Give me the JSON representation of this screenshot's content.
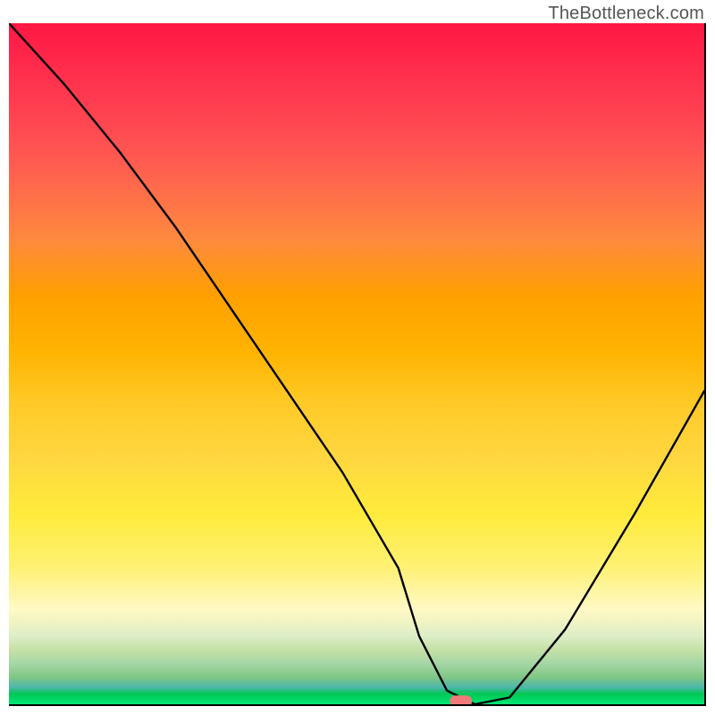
{
  "attribution": "TheBottleneck.com",
  "chart_data": {
    "type": "line",
    "title": "",
    "xlabel": "",
    "ylabel": "",
    "xlim": [
      0,
      100
    ],
    "ylim": [
      0,
      100
    ],
    "series": [
      {
        "name": "bottleneck-curve",
        "x": [
          0,
          8,
          16,
          24,
          32,
          40,
          48,
          56,
          59,
          63,
          67,
          72,
          80,
          90,
          100
        ],
        "y": [
          100,
          91,
          81,
          70,
          58,
          46,
          34,
          20,
          10,
          2,
          0,
          1,
          11,
          28,
          46
        ]
      }
    ],
    "marker": {
      "name": "optimal-point",
      "x": 65,
      "y": 0.5,
      "color": "#ef7a7a",
      "width_pct": 3.2,
      "height_pct": 1.6
    },
    "background": {
      "type": "vertical-gradient",
      "stops": [
        {
          "pct": 0,
          "color": "#ff1744"
        },
        {
          "pct": 25,
          "color": "#ff6e4a"
        },
        {
          "pct": 50,
          "color": "#ffca28"
        },
        {
          "pct": 75,
          "color": "#ffee58"
        },
        {
          "pct": 90,
          "color": "#dcedc8"
        },
        {
          "pct": 100,
          "color": "#00e676"
        }
      ]
    }
  }
}
